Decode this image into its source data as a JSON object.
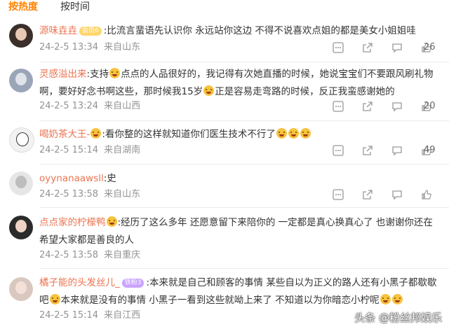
{
  "tabs": {
    "hot": "按热度",
    "time": "按时间"
  },
  "comments": [
    {
      "user": "源味垚垚",
      "badge": "会员6",
      "text": ":比流言蜚语先认识你 永远站你这边 不得不说喜欢点姐的都是美女小姐姐哇",
      "time": "24-2-5 13:34",
      "location": "来自山东",
      "likes": "26"
    },
    {
      "user": "灵感溢出来",
      "text_a": ":支持",
      "text_b": "点点的人品很好的，我记得有次她直播的时候，她说宝宝们不要跟风刷礼物啊，要好好念书啊这些，那时候我15岁",
      "text_c": "正是容易走弯路的时候，反正我蛮感谢她的",
      "time": "24-2-5 13:24",
      "location": "来自山西",
      "likes": "20"
    },
    {
      "user": "喝奶茶大王-",
      "text": ":看你整的这样就知道你们医生技术不行了",
      "time": "24-2-5 15:14",
      "location": "来自湖南",
      "likes": "49"
    },
    {
      "user": "oyynanaawsll",
      "text": ":史",
      "time": "24-2-5 13:58",
      "location": "来自山东",
      "likes": ""
    },
    {
      "user": "点点家的柠檬鸭",
      "text": ":经历了这么多年 还愿意留下来陪你的 一定都是真心换真心了 也谢谢你还在希望大家都是善良的人",
      "time": "24-2-5 13:58",
      "location": "来自重庆",
      "likes": ""
    },
    {
      "user": "橘子能的头发丝儿_",
      "badge": "铁粉3",
      "text_a": ":本来就是自己和顾客的事情 某些自以为正义的路人还有小黑子都歇歇吧",
      "text_b": "本来就是没有的事情 小黑子一看到这些就呦上来了 不知道以为你暗恋小柠呢",
      "time": "24-2-5 15:14",
      "location": "来自江西",
      "likes": ""
    }
  ],
  "watermark": "头条 @粉丝邦娱乐",
  "icons": [
    "more-icon",
    "share-icon",
    "comment-icon",
    "like-icon"
  ]
}
